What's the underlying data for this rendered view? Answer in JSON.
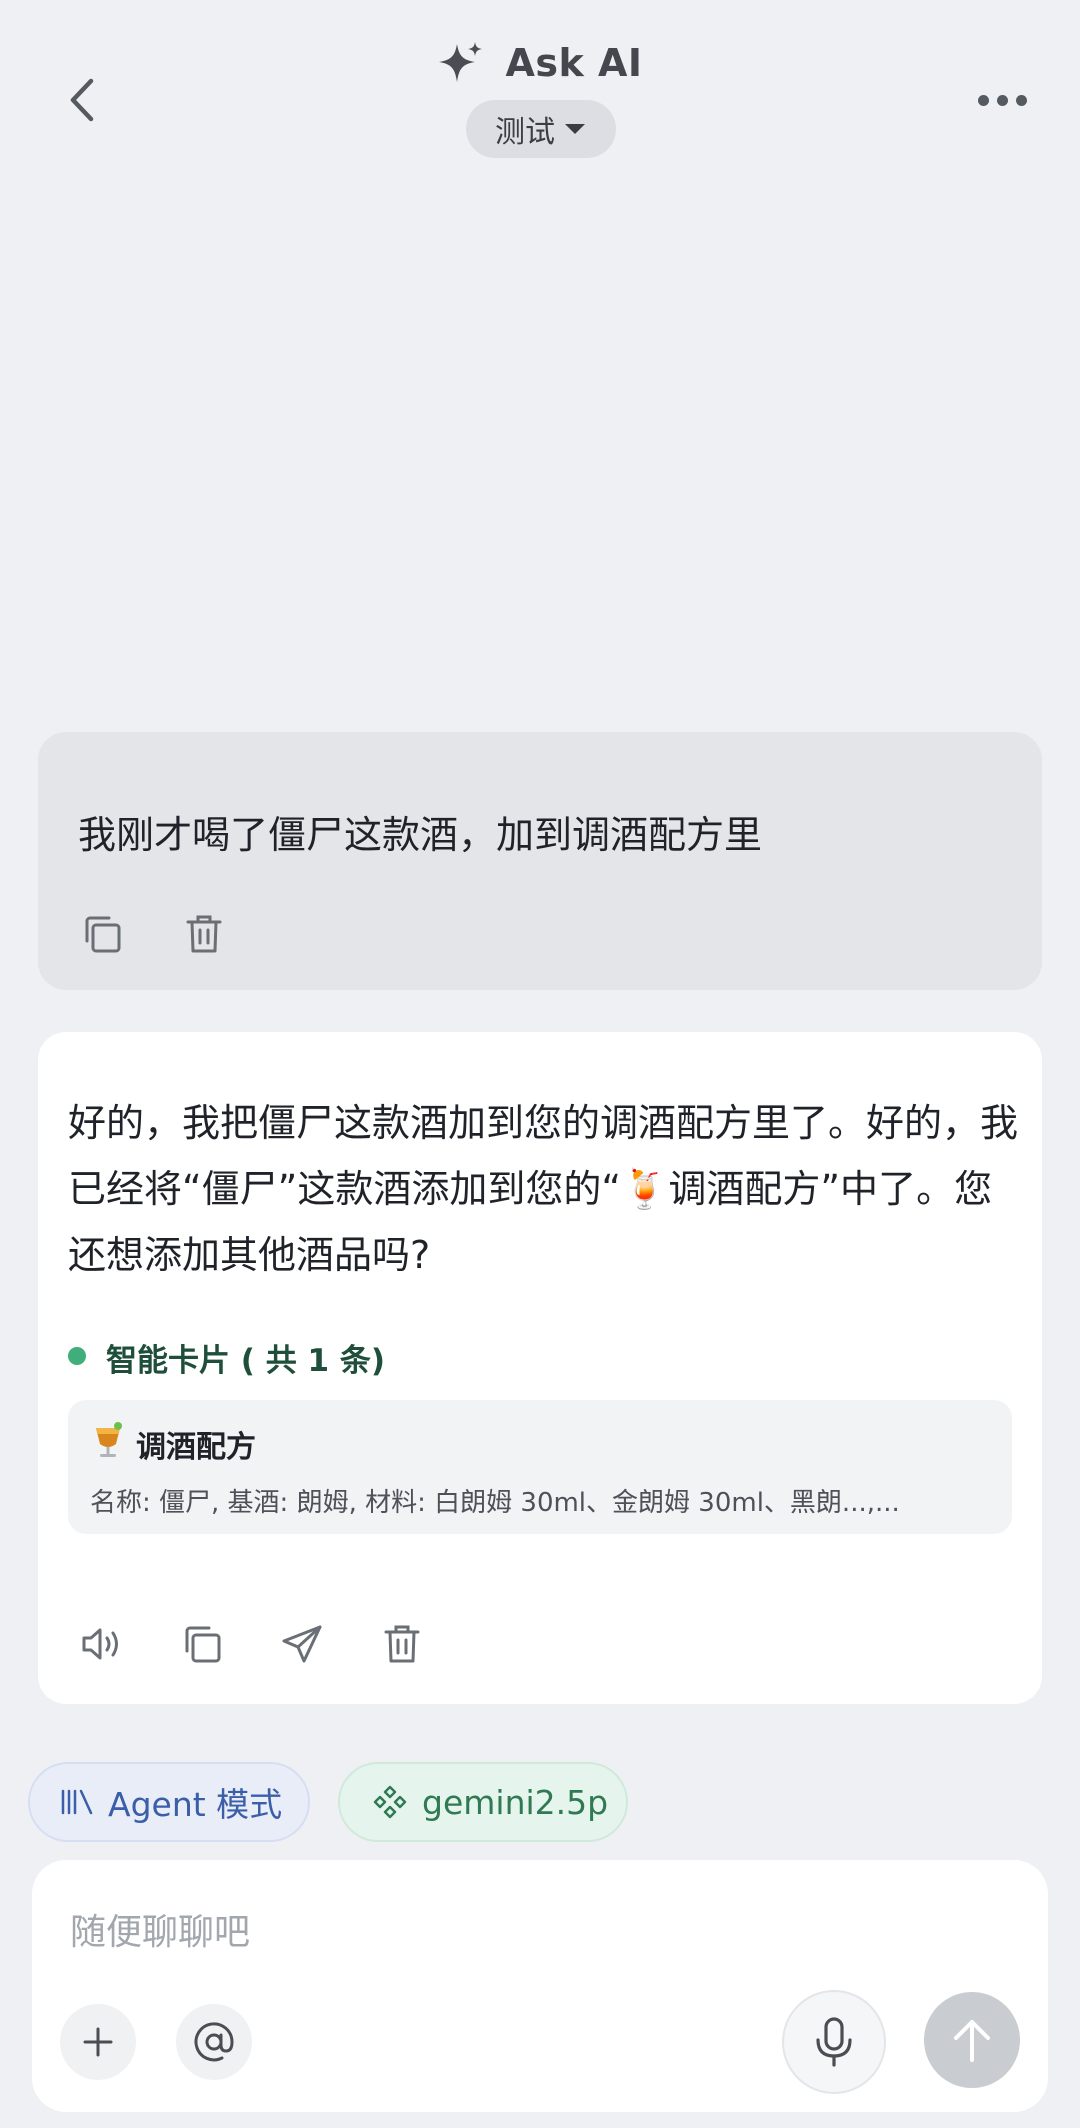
{
  "header": {
    "title": "Ask AI",
    "model_pill": "测试"
  },
  "conversation": {
    "user_message": "我刚才喝了僵尸这款酒，加到调酒配方里",
    "ai_message": "好的，我把僵尸这款酒加到您的调酒配方里了。好的，我已经将“僵尸”这款酒添加到您的“🍹调酒配方”中了。您还想添加其他酒品吗?",
    "smart_cards": {
      "title": "智能卡片 ( 共 1 条)",
      "items": [
        {
          "title": "调酒配方",
          "description": "名称: 僵尸, 基酒: 朗姆, 材料: 白朗姆 30ml、金朗姆 30ml、黑朗...,..."
        }
      ]
    }
  },
  "chips": {
    "agent_mode": "Agent 模式",
    "model": "gemini2.5p"
  },
  "composer": {
    "placeholder": "随便聊聊吧",
    "value": ""
  },
  "colors": {
    "background": "#eef0f4",
    "user_bubble": "#e3e5e9",
    "ai_bubble": "#ffffff",
    "agent_chip_text": "#3b5ea8",
    "model_chip_text": "#2f7a52",
    "smart_card_dot": "#3fae7a"
  },
  "icons": {
    "back": "chevron-left-icon",
    "title": "sparkle-icon",
    "pill": "caret-down-icon",
    "more": "more-dots-icon",
    "copy": "copy-icon",
    "delete": "trash-icon",
    "speaker": "speaker-icon",
    "share": "send-icon",
    "agent": "bars-icon",
    "model": "diamond-grid-icon",
    "add": "plus-icon",
    "mention": "at-icon",
    "mic": "microphone-icon",
    "send": "arrow-up-icon"
  }
}
